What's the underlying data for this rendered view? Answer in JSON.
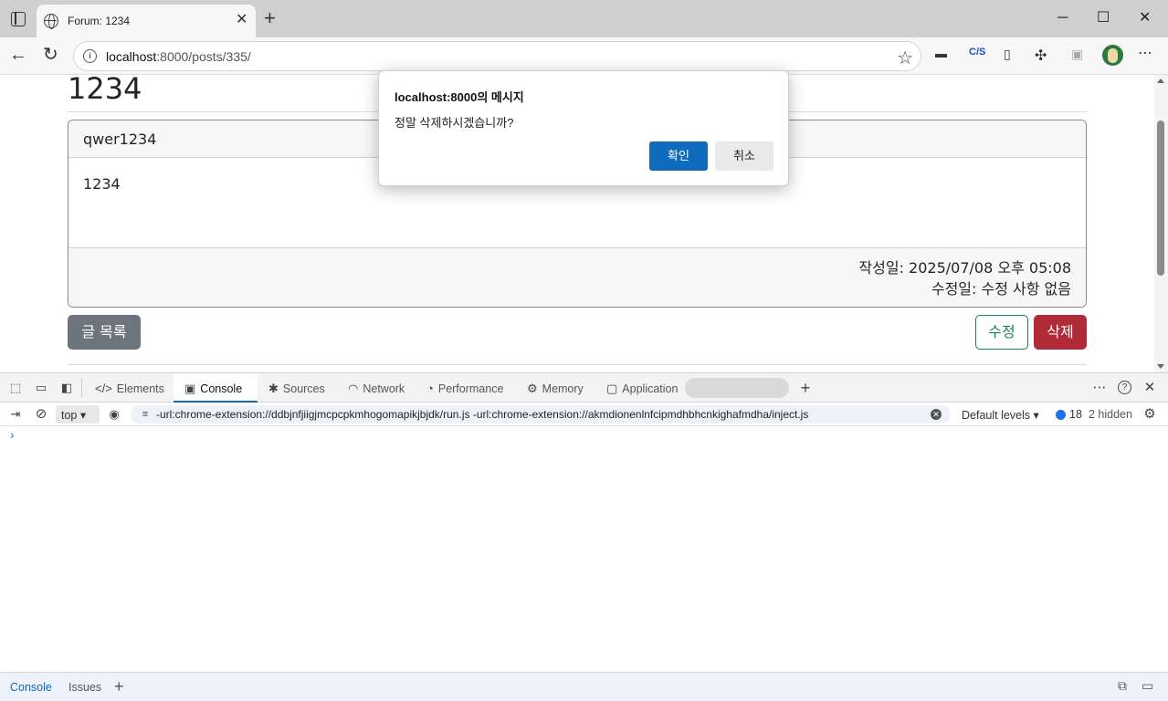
{
  "browser": {
    "tab_title": "Forum: 1234",
    "tab_close": "✕",
    "new_tab": "+",
    "url_host": "localhost",
    "url_rest": ":8000/posts/335/",
    "window_controls": {
      "minimize": "─",
      "maximize": "☐",
      "close": "✕"
    },
    "extensions": [
      "C/S"
    ]
  },
  "page": {
    "post_title": "1234",
    "author": "qwer1234",
    "content": "1234",
    "created": "작성일: 2025/07/08 오후 05:08",
    "modified": "수정일: 수정 사항 없음",
    "btn_list": "글 목록",
    "btn_edit": "수정",
    "btn_delete": "삭제"
  },
  "dialog": {
    "title": "localhost:8000의 메시지",
    "message": "정말 삭제하시겠습니까?",
    "ok": "확인",
    "cancel": "취소"
  },
  "devtools": {
    "tabs": [
      "Elements",
      "Console",
      "Sources",
      "Network",
      "Performance",
      "Memory",
      "Application"
    ],
    "active_tab": "Console",
    "context": "top",
    "filter": "-url:chrome-extension://ddbjnfjiigjmcpcpkmhogomapikjbjdk/run.js -url:chrome-extension://akmdionenlnfcipmdhbhcnkighafmdha/inject.js",
    "levels": "Default levels",
    "message_count": "18",
    "hidden": "2 hidden",
    "prompt": "›",
    "drawer_tabs": [
      "Console",
      "Issues"
    ]
  },
  "colors": {
    "primary": "#0f6cbd",
    "danger": "#b02a37",
    "success": "#198754",
    "secondary": "#6c757d"
  }
}
